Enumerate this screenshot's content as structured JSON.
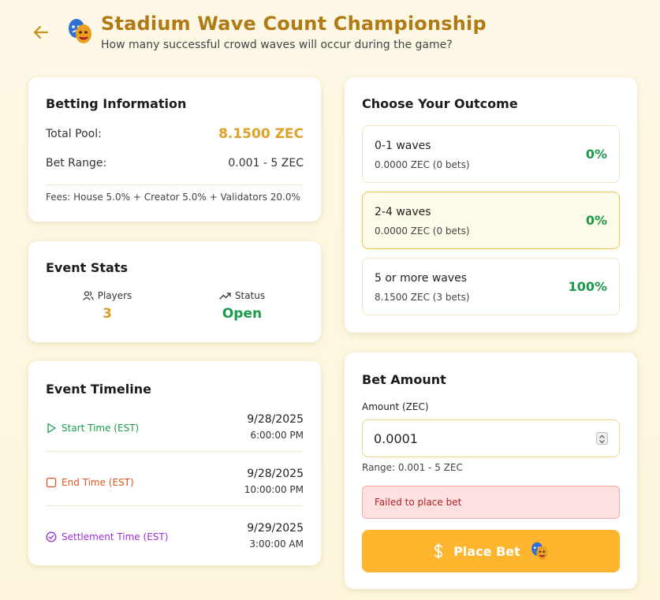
{
  "header": {
    "title": "Stadium Wave Count Championship",
    "subtitle": "How many successful crowd waves will occur during the game?",
    "logo_icon": "theater-masks-icon",
    "back_icon": "arrow-left-icon"
  },
  "betting_info": {
    "heading": "Betting Information",
    "total_pool_label": "Total Pool:",
    "total_pool_value": "8.1500 ZEC",
    "bet_range_label": "Bet Range:",
    "bet_range_value": "0.001 - 5 ZEC",
    "fees": "Fees: House 5.0% + Creator 5.0% + Validators 20.0%"
  },
  "event_stats": {
    "heading": "Event Stats",
    "players_label": "Players",
    "players_value": "3",
    "status_label": "Status",
    "status_value": "Open"
  },
  "timeline": {
    "heading": "Event Timeline",
    "items": [
      {
        "label": "Start Time (EST)",
        "date": "9/28/2025",
        "time": "6:00:00 PM",
        "color": "#1a9a4a",
        "icon": "play-icon"
      },
      {
        "label": "End Time (EST)",
        "date": "9/28/2025",
        "time": "10:00:00 PM",
        "color": "#e0531f",
        "icon": "stop-icon"
      },
      {
        "label": "Settlement Time (EST)",
        "date": "9/29/2025",
        "time": "3:00:00 AM",
        "color": "#9b2fd6",
        "icon": "check-circle-icon"
      }
    ]
  },
  "outcomes": {
    "heading": "Choose Your Outcome",
    "options": [
      {
        "name": "0-1 waves",
        "detail": "0.0000 ZEC (0 bets)",
        "percent": "0%"
      },
      {
        "name": "2-4 waves",
        "detail": "0.0000 ZEC (0 bets)",
        "percent": "0%"
      },
      {
        "name": "5 or more waves",
        "detail": "8.1500 ZEC (3 bets)",
        "percent": "100%"
      }
    ],
    "selected_index": 1
  },
  "bet_amount": {
    "heading": "Bet Amount",
    "label": "Amount (ZEC)",
    "value": "0.0001",
    "range_note": "Range: 0.001 - 5 ZEC",
    "error": "Failed to place bet",
    "button_label": "Place Bet",
    "button_icon": "dollar-icon"
  },
  "colors": {
    "accent": "#fdb52d",
    "title": "#b07a14",
    "success": "#1a9a4a"
  }
}
